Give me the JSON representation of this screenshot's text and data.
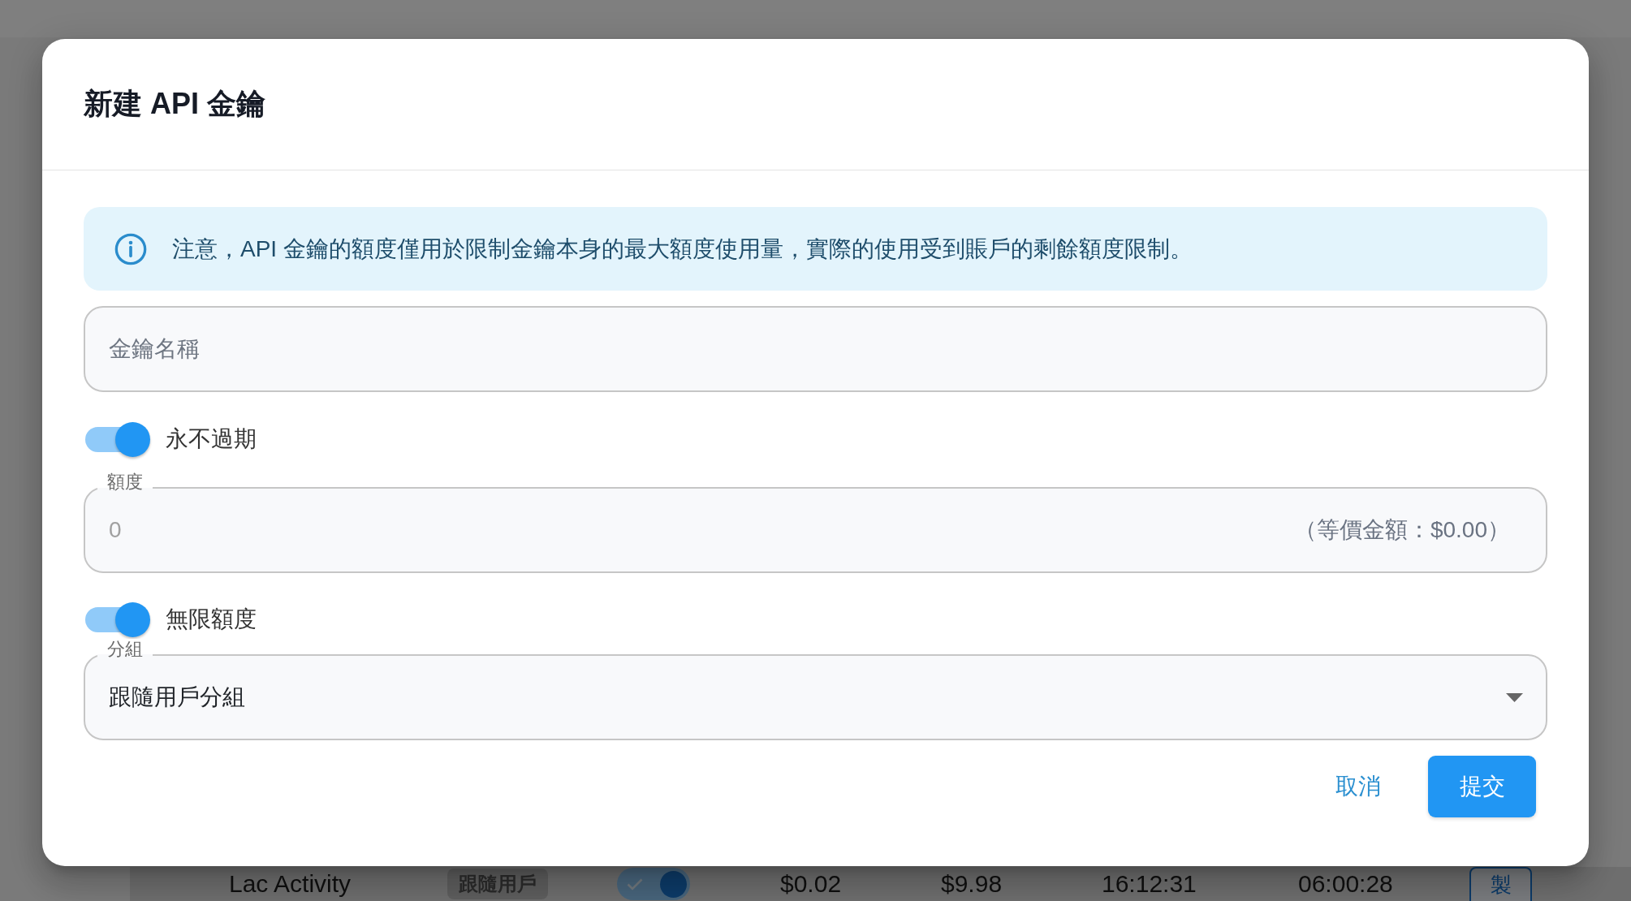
{
  "dialog": {
    "title": "新建 API 金鑰",
    "notice": {
      "kind": "info",
      "text": "注意，API 金鑰的額度僅用於限制金鑰本身的最大額度使用量，實際的使用受到賬戶的剩餘額度限制。"
    },
    "fields": [
      {
        "kind": "text",
        "placeholder": "金鑰名稱"
      },
      {
        "kind": "switch",
        "label": "永不過期",
        "on": true
      },
      {
        "kind": "number",
        "label": "額度",
        "value": "0",
        "adornment": "（等價金額：$0.00）",
        "disabled": true
      },
      {
        "kind": "switch",
        "label": "無限額度",
        "on": true
      },
      {
        "kind": "select",
        "label": "分組",
        "value": "跟隨用戶分組"
      }
    ],
    "actions": [
      {
        "kind": "text",
        "label": "取消"
      },
      {
        "kind": "contained",
        "label": "提交"
      }
    ]
  },
  "background": {
    "row": [
      {
        "kind": "text",
        "text": "Lac Activity"
      },
      {
        "kind": "tag",
        "text": "跟隨用戶"
      },
      {
        "kind": "switch",
        "on": true
      },
      {
        "kind": "text",
        "text": "$0.02"
      },
      {
        "kind": "text",
        "text": "$9.98"
      },
      {
        "kind": "text",
        "text": "16:12:31"
      },
      {
        "kind": "text",
        "text": "06:00:28"
      },
      {
        "kind": "button",
        "text": "製"
      }
    ]
  }
}
